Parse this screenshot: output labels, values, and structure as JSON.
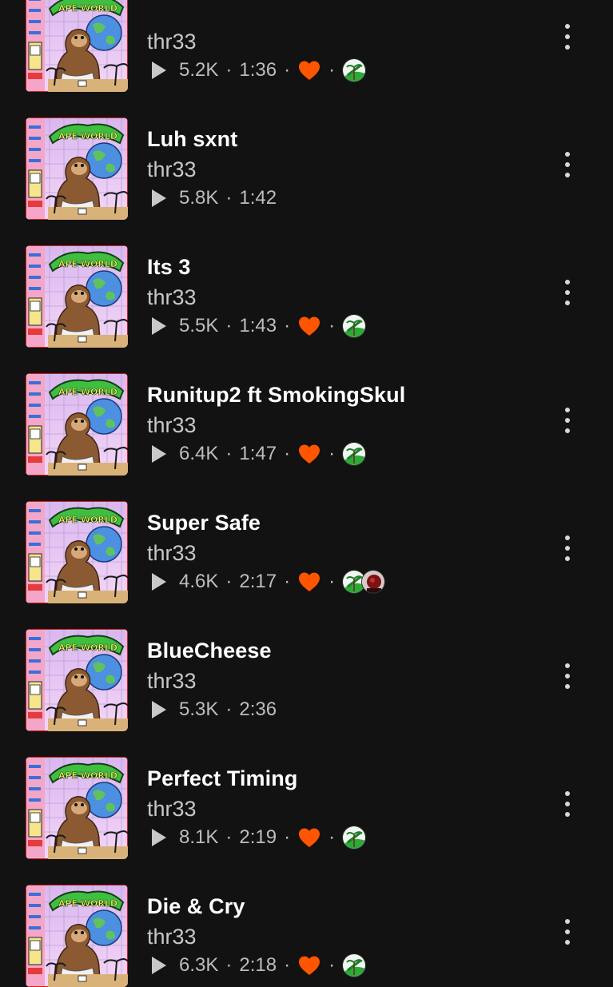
{
  "colors": {
    "background": "#121212",
    "title": "#ffffff",
    "artist": "#c7c7c7",
    "meta": "#bdbdbd",
    "heart": "#ff5500"
  },
  "icons": {
    "play": "play-icon",
    "like": "heart-icon",
    "more": "more-vertical-icon"
  },
  "separator": "·",
  "tracks": [
    {
      "title": "",
      "artist": "thr33",
      "plays": "5.2K",
      "duration": "1:36",
      "liked": true,
      "avatars": [
        "palm-tree-avatar"
      ]
    },
    {
      "title": "Luh sxnt",
      "artist": "thr33",
      "plays": "5.8K",
      "duration": "1:42",
      "liked": false,
      "avatars": []
    },
    {
      "title": "Its 3",
      "artist": "thr33",
      "plays": "5.5K",
      "duration": "1:43",
      "liked": true,
      "avatars": [
        "palm-tree-avatar"
      ]
    },
    {
      "title": "Runitup2 ft SmokingSkul",
      "artist": "thr33",
      "plays": "6.4K",
      "duration": "1:47",
      "liked": true,
      "avatars": [
        "palm-tree-avatar"
      ]
    },
    {
      "title": "Super Safe",
      "artist": "thr33",
      "plays": "4.6K",
      "duration": "2:17",
      "liked": true,
      "avatars": [
        "palm-tree-avatar",
        "red-portrait-avatar"
      ]
    },
    {
      "title": "BlueCheese",
      "artist": "thr33",
      "plays": "5.3K",
      "duration": "2:36",
      "liked": false,
      "avatars": []
    },
    {
      "title": "Perfect Timing",
      "artist": "thr33",
      "plays": "8.1K",
      "duration": "2:19",
      "liked": true,
      "avatars": [
        "palm-tree-avatar"
      ]
    },
    {
      "title": "Die & Cry",
      "artist": "thr33",
      "plays": "6.3K",
      "duration": "2:18",
      "liked": true,
      "avatars": [
        "palm-tree-avatar"
      ]
    }
  ]
}
